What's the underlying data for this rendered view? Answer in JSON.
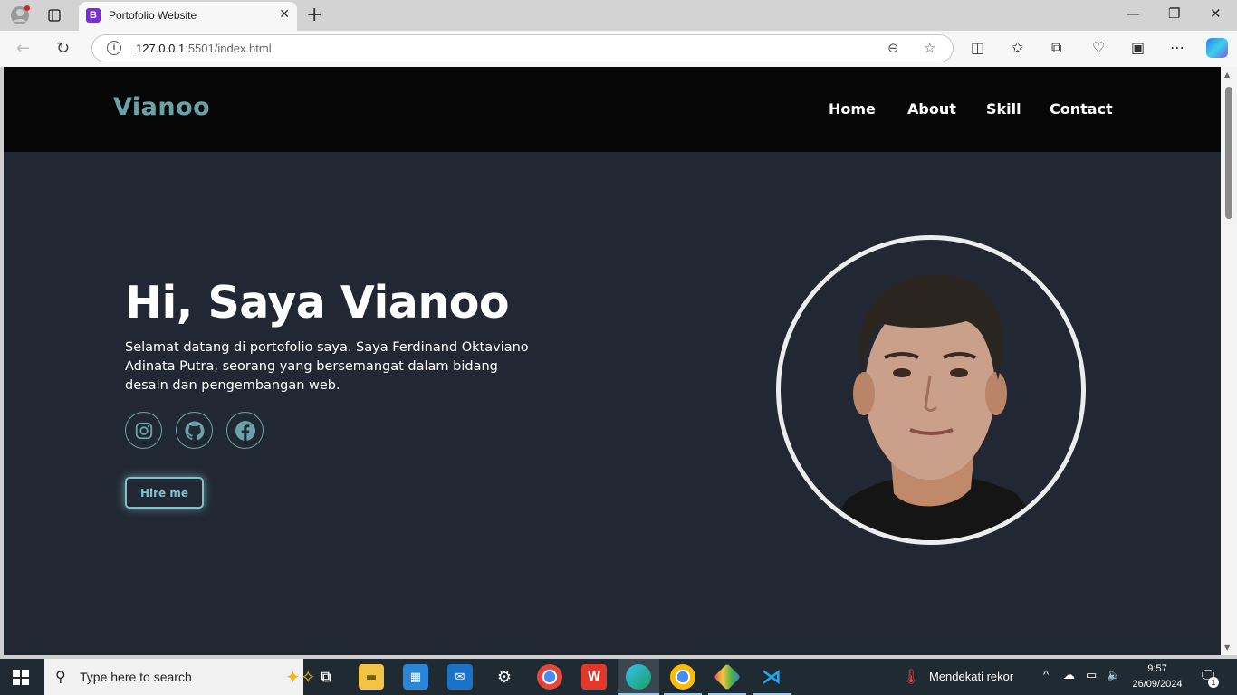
{
  "browser": {
    "tab_title": "Portofolio Website",
    "url_host": "127.0.0.1",
    "url_path": ":5501/index.html",
    "tab_favicon_letter": "B"
  },
  "site": {
    "brand": "Vianoo",
    "nav": [
      "Home",
      "About",
      "Skill",
      "Contact"
    ],
    "hero_title": "Hi, Saya Vianoo",
    "hero_description": "Selamat datang di portofolio saya. Saya Ferdinand Oktaviano Adinata Putra, seorang yang bersemangat dalam bidang desain dan pengembangan web.",
    "social_icons": [
      "instagram-icon",
      "github-icon",
      "facebook-icon"
    ],
    "hire_button": "Hire me",
    "colors": {
      "accent": "#6aa2aa",
      "header_bg": "#060606",
      "page_bg": "#222833"
    }
  },
  "taskbar": {
    "search_placeholder": "Type here to search",
    "weather_text": "Mendekati rekor",
    "time": "9:57",
    "date": "26/09/2024",
    "notification_count": "1"
  }
}
